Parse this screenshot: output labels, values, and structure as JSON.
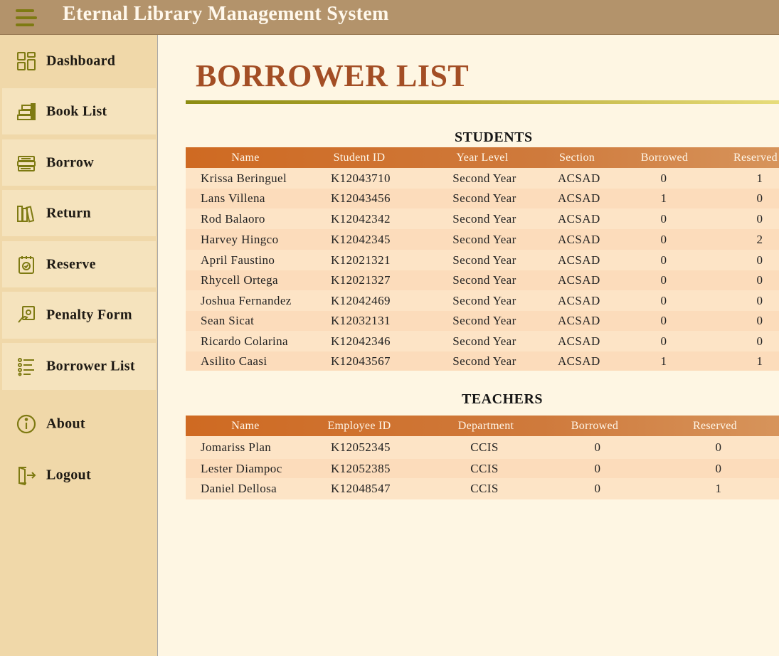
{
  "app": {
    "title": "Eternal Library Management System"
  },
  "sidebar": {
    "items": [
      {
        "label": "Dashboard",
        "icon": "dashboard-icon"
      },
      {
        "label": "Book List",
        "icon": "books-stack-icon"
      },
      {
        "label": "Borrow",
        "icon": "book-borrow-icon"
      },
      {
        "label": "Return",
        "icon": "books-return-icon"
      },
      {
        "label": "Reserve",
        "icon": "reserve-notepad-icon"
      },
      {
        "label": "Penalty Form",
        "icon": "penalty-hand-icon"
      },
      {
        "label": "Borrower List",
        "icon": "list-icon"
      },
      {
        "label": "About",
        "icon": "info-icon"
      },
      {
        "label": "Logout",
        "icon": "logout-icon"
      }
    ]
  },
  "main": {
    "title": "BORROWER LIST",
    "students": {
      "heading": "STUDENTS",
      "columns": [
        "Name",
        "Student ID",
        "Year Level",
        "Section",
        "Borrowed",
        "Reserved"
      ],
      "rows": [
        [
          "Krissa Beringuel",
          "K12043710",
          "Second Year",
          "ACSAD",
          "0",
          "1"
        ],
        [
          "Lans Villena",
          "K12043456",
          "Second Year",
          "ACSAD",
          "1",
          "0"
        ],
        [
          "Rod Balaoro",
          "K12042342",
          "Second Year",
          "ACSAD",
          "0",
          "0"
        ],
        [
          "Harvey Hingco",
          "K12042345",
          "Second Year",
          "ACSAD",
          "0",
          "2"
        ],
        [
          "April Faustino",
          "K12021321",
          "Second Year",
          "ACSAD",
          "0",
          "0"
        ],
        [
          "Rhycell Ortega",
          "K12021327",
          "Second Year",
          "ACSAD",
          "0",
          "0"
        ],
        [
          "Joshua Fernandez",
          "K12042469",
          "Second Year",
          "ACSAD",
          "0",
          "0"
        ],
        [
          "Sean Sicat",
          "K12032131",
          "Second Year",
          "ACSAD",
          "0",
          "0"
        ],
        [
          "Ricardo Colarina",
          "K12042346",
          "Second Year",
          "ACSAD",
          "0",
          "0"
        ],
        [
          "Asilito Caasi",
          "K12043567",
          "Second Year",
          "ACSAD",
          "1",
          "1"
        ]
      ]
    },
    "teachers": {
      "heading": "TEACHERS",
      "columns": [
        "Name",
        "Employee ID",
        "Department",
        "Borrowed",
        "Reserved"
      ],
      "rows": [
        [
          "Jomariss Plan",
          "K12052345",
          "CCIS",
          "0",
          "0"
        ],
        [
          "Lester Diampoc",
          "K12052385",
          "CCIS",
          "0",
          "0"
        ],
        [
          "Daniel Dellosa",
          "K12048547",
          "CCIS",
          "0",
          "1"
        ]
      ]
    }
  },
  "colors": {
    "titlebar": "#b3936b",
    "sidebar": "#f0d8a9",
    "page_title": "#a34e25",
    "table_header": "#cf6a22",
    "row_bg": "#fde4c6",
    "icon_olive": "#7e7a12"
  }
}
